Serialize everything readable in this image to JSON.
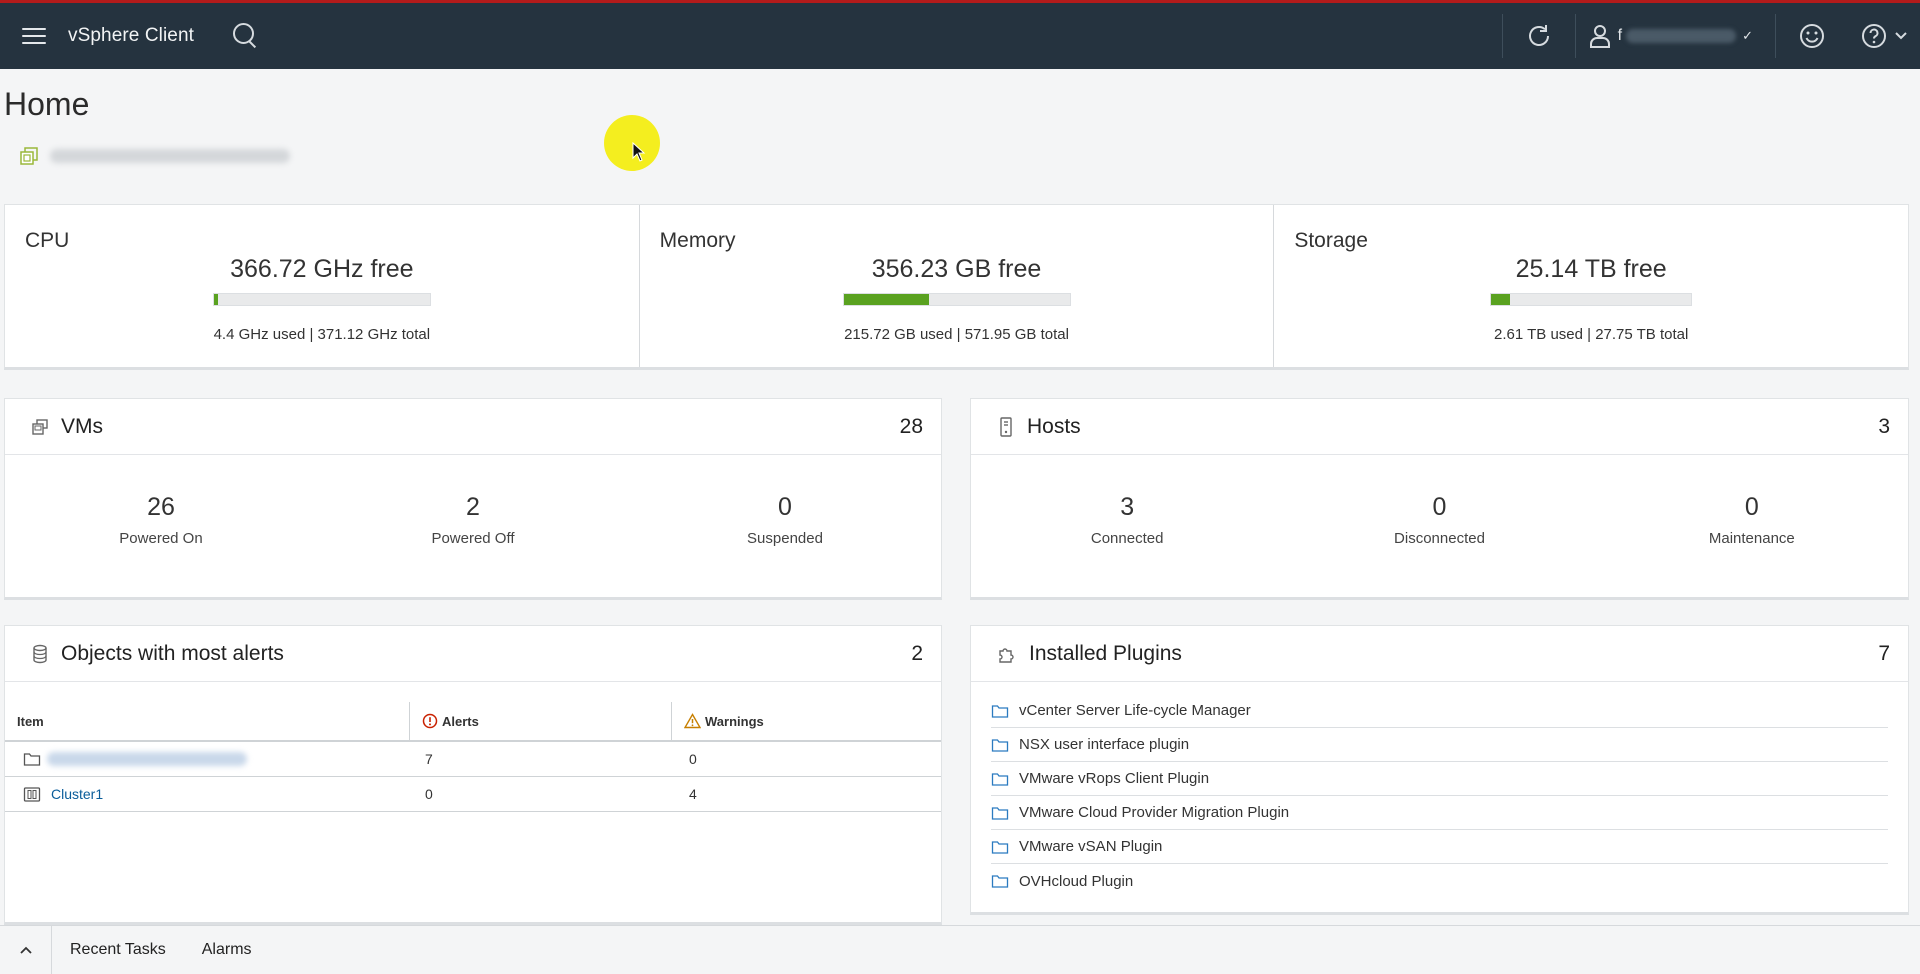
{
  "header": {
    "app_title": "vSphere Client",
    "user_initial": "f",
    "icons": [
      "menu-icon",
      "search-icon",
      "refresh-icon",
      "user-icon",
      "smiley-icon",
      "help-icon"
    ]
  },
  "page": {
    "title": "Home"
  },
  "resources": {
    "cpu": {
      "title": "CPU",
      "free": "366.72 GHz free",
      "detail": "4.4 GHz used | 371.12 GHz total",
      "used_fraction": 0.012
    },
    "memory": {
      "title": "Memory",
      "free": "356.23 GB free",
      "detail": "215.72 GB used | 571.95 GB total",
      "used_fraction": 0.377
    },
    "storage": {
      "title": "Storage",
      "free": "25.14 TB free",
      "detail": "2.61 TB used | 27.75 TB total",
      "used_fraction": 0.094
    }
  },
  "vms": {
    "title": "VMs",
    "count": "28",
    "stats": [
      {
        "value": "26",
        "label": "Powered On"
      },
      {
        "value": "2",
        "label": "Powered Off"
      },
      {
        "value": "0",
        "label": "Suspended"
      }
    ]
  },
  "hosts": {
    "title": "Hosts",
    "count": "3",
    "stats": [
      {
        "value": "3",
        "label": "Connected"
      },
      {
        "value": "0",
        "label": "Disconnected"
      },
      {
        "value": "0",
        "label": "Maintenance"
      }
    ]
  },
  "alerts": {
    "title": "Objects with most alerts",
    "count": "2",
    "columns": {
      "item": "Item",
      "alerts": "Alerts",
      "warnings": "Warnings"
    },
    "rows": [
      {
        "item": "",
        "alerts": "7",
        "warnings": "0"
      },
      {
        "item": "Cluster1",
        "alerts": "0",
        "warnings": "4"
      }
    ]
  },
  "plugins": {
    "title": "Installed Plugins",
    "count": "7",
    "items": [
      "vCenter Server Life-cycle Manager",
      "NSX user interface plugin",
      "VMware vRops Client Plugin",
      "VMware Cloud Provider Migration Plugin",
      "VMware vSAN Plugin",
      "OVHcloud Plugin"
    ]
  },
  "bottom_bar": {
    "recent_tasks": "Recent Tasks",
    "alarms": "Alarms"
  },
  "colors": {
    "header_bg": "#25333f",
    "header_accent": "#b31b1b",
    "bar_fill": "#5aa220",
    "link": "#0a5d9a"
  }
}
